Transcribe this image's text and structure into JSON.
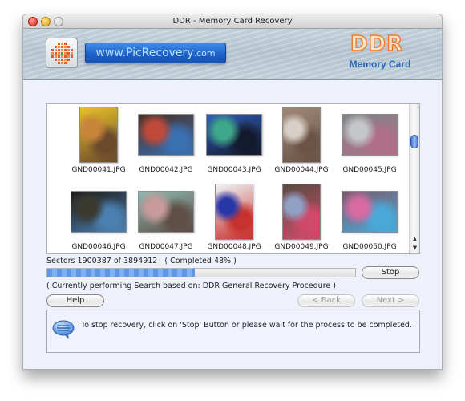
{
  "window": {
    "title": "DDR - Memory Card Recovery"
  },
  "banner": {
    "website_link": "www.PicRecovery",
    "website_suffix": ".com",
    "brand_name": "DDR",
    "brand_subtitle": "Memory Card"
  },
  "gallery": {
    "files": [
      {
        "name": "GND00041.JPG",
        "orientation": "portrait",
        "colors": [
          "#e7c12a",
          "#c8843b",
          "#6b4a2c"
        ]
      },
      {
        "name": "GND00042.JPG",
        "orientation": "landscape",
        "colors": [
          "#4a2f22",
          "#c04a3a",
          "#3a6fb0"
        ]
      },
      {
        "name": "GND00043.JPG",
        "orientation": "landscape",
        "colors": [
          "#2f5db8",
          "#3fa88a",
          "#141a2e"
        ]
      },
      {
        "name": "GND00044.JPG",
        "orientation": "portrait",
        "colors": [
          "#a08878",
          "#d8cfc6",
          "#6b5346"
        ]
      },
      {
        "name": "GND00045.JPG",
        "orientation": "landscape",
        "colors": [
          "#7f8388",
          "#c4c6c8",
          "#b06f88"
        ]
      },
      {
        "name": "GND00046.JPG",
        "orientation": "landscape",
        "colors": [
          "#1d1a17",
          "#3a3a30",
          "#4b7fb0"
        ]
      },
      {
        "name": "GND00047.JPG",
        "orientation": "landscape",
        "colors": [
          "#8fb9b2",
          "#c89a9a",
          "#5e4e46"
        ]
      },
      {
        "name": "GND00048.JPG",
        "orientation": "portrait",
        "colors": [
          "#eef4f6",
          "#2737a8",
          "#c8322e"
        ]
      },
      {
        "name": "GND00049.JPG",
        "orientation": "portrait",
        "colors": [
          "#5a4a42",
          "#8fa0c4",
          "#cf4a6a"
        ]
      },
      {
        "name": "GND00050.JPG",
        "orientation": "landscape",
        "colors": [
          "#7a5a6a",
          "#d86aa2",
          "#4aa8d8"
        ]
      }
    ],
    "scroll_up_label": "▲",
    "scroll_down_label": "▼"
  },
  "status": {
    "sectors_text": "Sectors 1900387 of 3894912   ( Completed 48% )",
    "progress_percent": 48,
    "procedure_text": "( Currently performing Search based on: DDR General Recovery Procedure )"
  },
  "buttons": {
    "stop": "Stop",
    "help": "Help",
    "back": "< Back",
    "next": "Next >"
  },
  "info": {
    "icon": "speech-bubble-icon",
    "message": "To stop recovery, click on 'Stop' Button or please wait for the process to be completed."
  }
}
